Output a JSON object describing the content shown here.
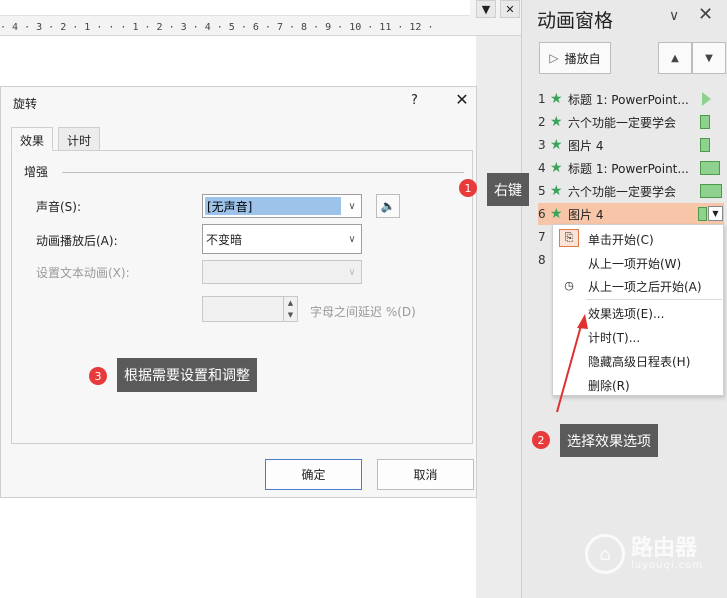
{
  "ruler": {
    "ticks": "· 4 · 3 · 2 · 1 · · · 1 · 2 · 3 · 4 · 5 · 6 · 7 · 8 · 9 · 10 · 11 · 12 ·",
    "dropdown_glyph": "▼",
    "close_glyph": "✕"
  },
  "dialog": {
    "title": "旋转",
    "help": "?",
    "close": "✕",
    "tabs": [
      "效果",
      "计时"
    ],
    "section": "增强",
    "sound_label": "声音(S):",
    "sound_value": "[无声音]",
    "after_label": "动画播放后(A):",
    "after_value": "不变暗",
    "text_anim_label": "设置文本动画(X):",
    "delay_label": "字母之间延迟 %(D)",
    "ok": "确定",
    "cancel": "取消"
  },
  "pane": {
    "title": "动画窗格",
    "play_label": "播放自",
    "items": [
      {
        "num": "1",
        "name": "标题 1: PowerPoint..."
      },
      {
        "num": "2",
        "name": "六个功能一定要学会"
      },
      {
        "num": "3",
        "name": "图片 4"
      },
      {
        "num": "4",
        "name": "标题 1: PowerPoint..."
      },
      {
        "num": "5",
        "name": "六个功能一定要学会"
      },
      {
        "num": "6",
        "name": "图片 4"
      }
    ],
    "hidden_nums": [
      "7",
      "8"
    ]
  },
  "menu": {
    "items": [
      "单击开始(C)",
      "从上一项开始(W)",
      "从上一项之后开始(A)",
      "效果选项(E)...",
      "计时(T)...",
      "隐藏高级日程表(H)",
      "删除(R)"
    ]
  },
  "annotations": {
    "step1": {
      "badge": "1",
      "text": "右键"
    },
    "step2": {
      "badge": "2",
      "text": "选择效果选项"
    },
    "step3": {
      "badge": "3",
      "text": "根据需要设置和调整"
    },
    "colors": {
      "callout": "#5a5a5a",
      "badge": "#e83a3a",
      "arrow": "#e03030",
      "highlight": "#f7c6a8"
    }
  },
  "watermark": {
    "brand": "路由器",
    "site": "luyouqi.com"
  }
}
